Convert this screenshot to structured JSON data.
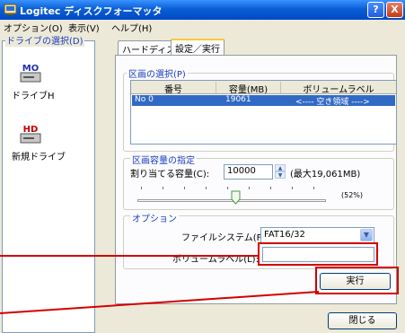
{
  "window": {
    "title": "Logitec ディスクフォーマッタ"
  },
  "titlebar": {
    "help_label": "?",
    "close_label": "X"
  },
  "menu": [
    "オプション(O)",
    "表示(V)",
    "ヘルプ(H)"
  ],
  "drive_pane": {
    "title": "ドライブの選択(D)",
    "drives": [
      {
        "badge": "MO",
        "label": "ドライブH"
      },
      {
        "badge": "HD",
        "label": "新規ドライブ"
      }
    ]
  },
  "tabs": [
    "ハードディスク",
    "設定／実行"
  ],
  "partition_select": {
    "title": "区画の選択(P)",
    "columns": [
      "番号",
      "容量(MB)",
      "ボリュームラベル"
    ],
    "rows": [
      {
        "number": "No 0",
        "size": "19061",
        "label": "<---- 空き領域 ---->"
      }
    ]
  },
  "partition_size": {
    "title": "区画容量の指定",
    "capacity_label": "割り当てる容量(C):",
    "capacity_value": "10000",
    "max_label": "(最大19,061MB)",
    "percent_label": "(52%)",
    "slider_fraction": 0.52
  },
  "options": {
    "title": "オプション",
    "filesystem_label": "ファイルシステム(F):",
    "filesystem_value": "FAT16/32",
    "volume_label_label": "ボリュームラベル(L):",
    "volume_label_value": ""
  },
  "buttons": {
    "execute": "実行",
    "close": "閉じる"
  },
  "colors": {
    "highlight_red": "#d40000",
    "selection_blue": "#316ac5",
    "title_blue": "#0a5fd6"
  }
}
